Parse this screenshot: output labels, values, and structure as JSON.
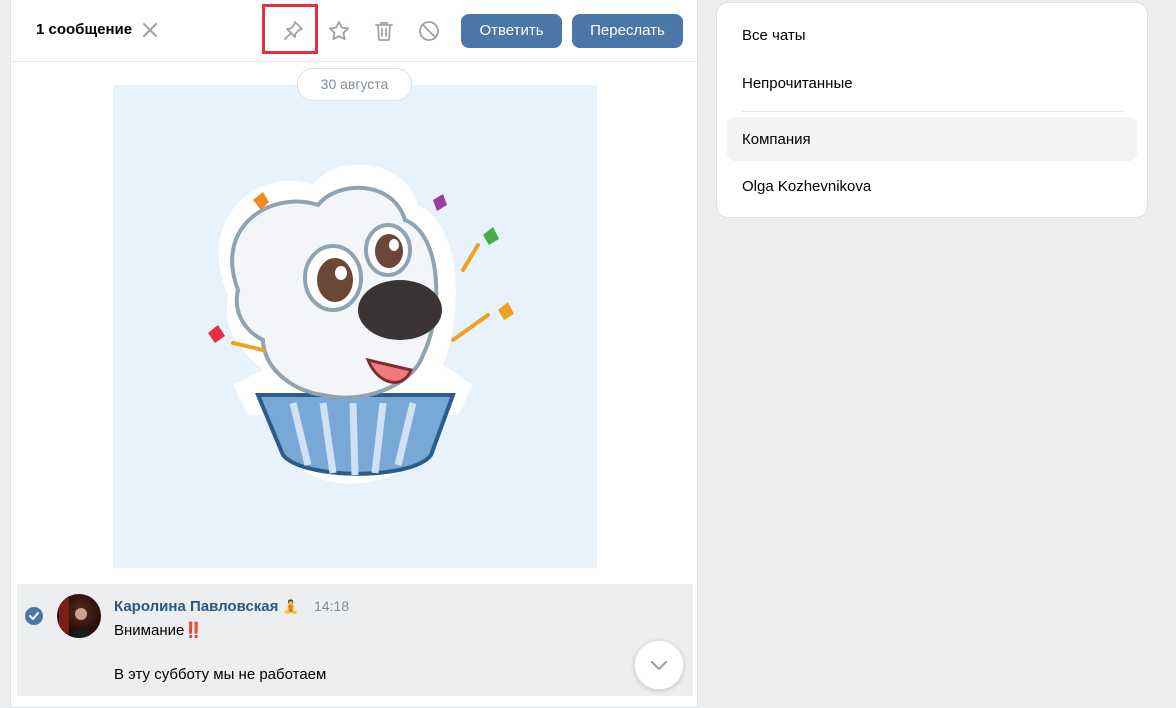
{
  "toolbar": {
    "selected_count": "1 сообщение",
    "reply_label": "Ответить",
    "forward_label": "Переслать"
  },
  "date_separator": "30 августа",
  "message": {
    "author": "Каролина Павловская",
    "author_emoji": "🧘",
    "time": "14:18",
    "line1": "Внимание",
    "line1_emoji": "‼️",
    "line2": "В эту субботу мы не работаем"
  },
  "sidebar": {
    "items": [
      {
        "label": "Все чаты"
      },
      {
        "label": "Непрочитанные"
      },
      {
        "label": "Компания"
      },
      {
        "label": "Olga Kozhevnikova"
      }
    ],
    "active_index": 2
  },
  "colors": {
    "accent": "#4a76a8",
    "author_link": "#2a5885",
    "highlight_box": "#e62e3e",
    "sticker_bg": "#e8f2fc"
  },
  "icons": [
    "close-icon",
    "pin-icon",
    "star-icon",
    "trash-icon",
    "block-icon",
    "checkmark-icon",
    "chevron-down-icon"
  ]
}
